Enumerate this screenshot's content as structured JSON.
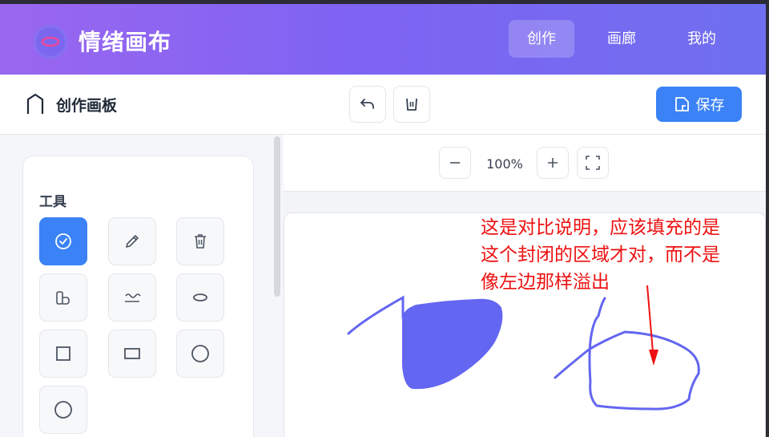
{
  "app": {
    "title": "情绪画布"
  },
  "nav": {
    "items": [
      {
        "label": "创作"
      },
      {
        "label": "画廊"
      },
      {
        "label": "我的"
      }
    ]
  },
  "toolbar": {
    "board_title": "创作画板",
    "save_label": "保存"
  },
  "tools": {
    "label": "工具",
    "items": [
      {
        "icon": "select-check-icon",
        "active": true
      },
      {
        "icon": "pencil-icon"
      },
      {
        "icon": "eraser-trash-icon"
      },
      {
        "icon": "fill-bucket-icon"
      },
      {
        "icon": "wave-line-icon"
      },
      {
        "icon": "ellipse-icon"
      },
      {
        "icon": "square-icon"
      },
      {
        "icon": "rectangle-icon"
      },
      {
        "icon": "circle-icon"
      },
      {
        "icon": "circle-outline-icon"
      }
    ]
  },
  "zoom": {
    "level": "100%"
  },
  "annotation": {
    "lines": [
      "这是对比说明，应该填充的是",
      "这个封闭的区域才对，而不是",
      "像左边那样溢出"
    ]
  },
  "colors": {
    "accent": "#3b82f6",
    "stroke": "#6366f1",
    "annotation": "#ee1111",
    "header_start": "#9a67f0",
    "header_end": "#6f6ff0"
  }
}
